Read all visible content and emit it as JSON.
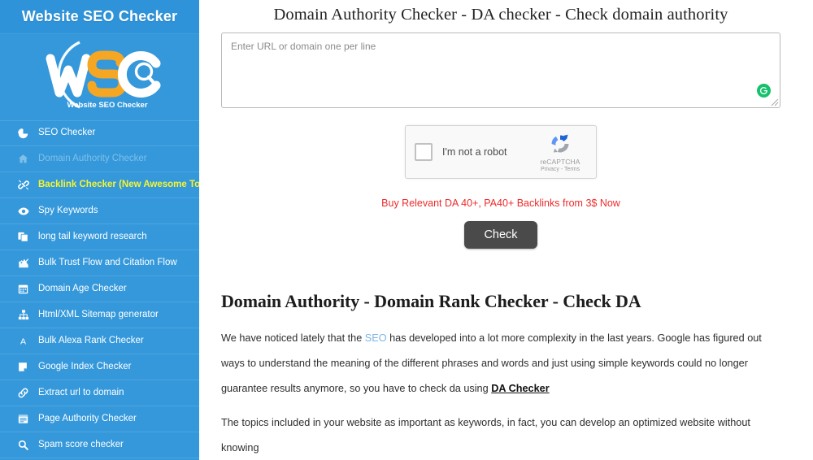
{
  "sidebar": {
    "brand": "Website SEO Checker",
    "logo": {
      "letters": "WSC",
      "tagline": "Website SEO Checker",
      "colors": {
        "letter_primary": "#ffffff",
        "letter_accent": "#f5a623",
        "background": "#3498db"
      }
    },
    "items": [
      {
        "label": "SEO Checker",
        "icon": "pie-chart-icon",
        "state": "normal"
      },
      {
        "label": "Domain Authority Checker",
        "icon": "home-icon",
        "state": "dim"
      },
      {
        "label": "Backlink Checker (New Awesome Tool)",
        "icon": "broken-link-icon",
        "state": "highlight"
      },
      {
        "label": "Spy Keywords",
        "icon": "eye-icon",
        "state": "normal"
      },
      {
        "label": "long tail keyword research",
        "icon": "copy-documents-icon",
        "state": "normal"
      },
      {
        "label": "Bulk Trust Flow and Citation Flow",
        "icon": "line-chart-icon",
        "state": "normal"
      },
      {
        "label": "Domain Age Checker",
        "icon": "calendar-icon",
        "state": "normal"
      },
      {
        "label": "Html/XML Sitemap generator",
        "icon": "sitemap-icon",
        "state": "normal"
      },
      {
        "label": "Bulk Alexa Rank Checker",
        "icon": "letter-a-icon",
        "state": "normal"
      },
      {
        "label": "Google Index Checker",
        "icon": "sticky-note-icon",
        "state": "normal"
      },
      {
        "label": "Extract url to domain",
        "icon": "chain-link-icon",
        "state": "normal"
      },
      {
        "label": "Page Authority Checker",
        "icon": "file-lines-icon",
        "state": "normal"
      },
      {
        "label": "Spam score checker",
        "icon": "magnifier-icon",
        "state": "normal"
      }
    ]
  },
  "main": {
    "title": "Domain Authority Checker - DA checker - Check domain authority",
    "input": {
      "placeholder": "Enter URL or domain one per line",
      "value": ""
    },
    "grammarly": {
      "letter": "G",
      "color": "#15c26b"
    },
    "recaptcha": {
      "label": "I'm not a robot",
      "brand": "reCAPTCHA",
      "terms": "Privacy - Terms",
      "checked": false
    },
    "promo": {
      "text": "Buy Relevant DA 40+, PA40+ Backlinks from 3$ Now",
      "color": "#ee2b2b"
    },
    "check_button": {
      "label": "Check",
      "color": "#4a4a4a"
    }
  },
  "article": {
    "title": "Domain Authority - Domain Rank Checker - Check DA",
    "p1_before": "We have noticed lately that the ",
    "p1_link": "SEO",
    "p1_after": " has developed into a lot more complexity in the last years. Google has figured out ways to understand the meaning of the different phrases and words and just using simple keywords could no longer guarantee results anymore, so you have to check da using ",
    "p1_link2": "DA Checker",
    "p2": "The topics included in your website as important as keywords, in fact, you can develop an optimized website without knowing"
  }
}
